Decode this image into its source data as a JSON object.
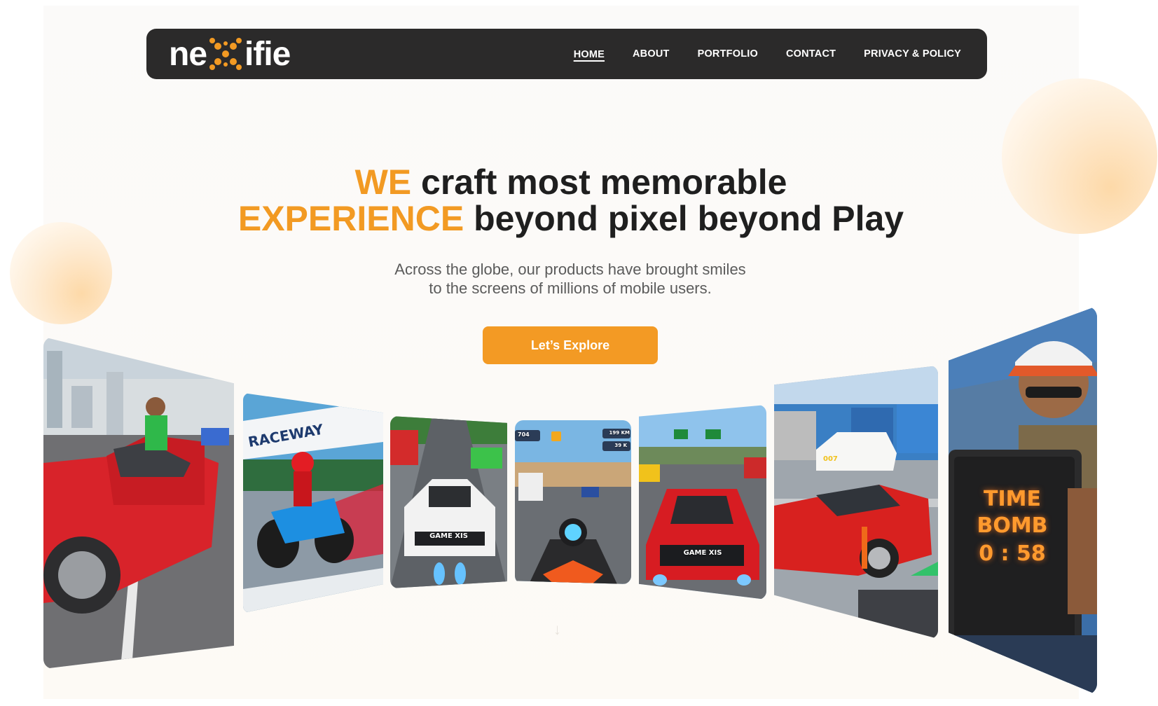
{
  "brand": {
    "name_prefix": "ne",
    "name_suffix": "ifie",
    "accent_color": "#f29a23"
  },
  "nav": {
    "items": [
      {
        "label": "HOME",
        "active": true
      },
      {
        "label": "ABOUT",
        "active": false
      },
      {
        "label": "PORTFOLIO",
        "active": false
      },
      {
        "label": "CONTACT",
        "active": false
      },
      {
        "label": "PRIVACY & POLICY",
        "active": false
      }
    ]
  },
  "hero": {
    "line1_accent": "WE",
    "line1_rest": " craft most memorable",
    "line2_accent": "EXPERIENCE",
    "line2_rest": " beyond pixel beyond Play",
    "subtitle_line1": "Across the globe, our products have brought smiles",
    "subtitle_line2": "to the screens of millions of mobile users.",
    "cta_label": "Let’s Explore"
  },
  "gallery": {
    "cards": [
      {
        "name": "car-thief-game",
        "texts": []
      },
      {
        "name": "moto-raceway-game",
        "texts": [
          "RACEWAY"
        ]
      },
      {
        "name": "car-racing-game",
        "texts": [
          "GAME XIS"
        ]
      },
      {
        "name": "bike-racing-game",
        "texts": [
          "704",
          "199 KM",
          "39 K"
        ]
      },
      {
        "name": "highway-racing-game",
        "texts": [
          "GAME XIS"
        ]
      },
      {
        "name": "car-parking-game",
        "texts": [
          "007"
        ]
      },
      {
        "name": "time-bomb-game",
        "texts": [
          "TIME",
          "BOMB",
          "0 : 58"
        ]
      }
    ]
  },
  "icons": {
    "scroll": "arrow-down-icon"
  }
}
